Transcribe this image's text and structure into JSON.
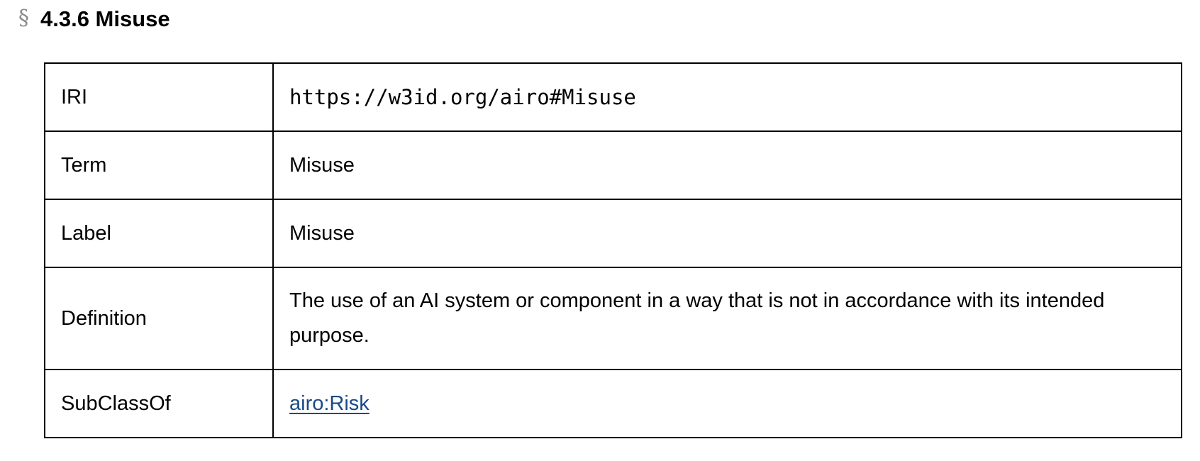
{
  "section": {
    "mark": "§",
    "title": "4.3.6 Misuse"
  },
  "table": {
    "rows": [
      {
        "key": "IRI",
        "value": "https://w3id.org/airo#Misuse"
      },
      {
        "key": "Term",
        "value": "Misuse"
      },
      {
        "key": "Label",
        "value": "Misuse"
      },
      {
        "key": "Definition",
        "value": "The use of an AI system or component in a way that is not in accordance with its intended purpose."
      },
      {
        "key": "SubClassOf",
        "value": "airo:Risk"
      }
    ]
  },
  "colors": {
    "text": "#000000",
    "section_mark": "#8a8a8a",
    "link": "#1a4a8a",
    "border": "#000000"
  }
}
